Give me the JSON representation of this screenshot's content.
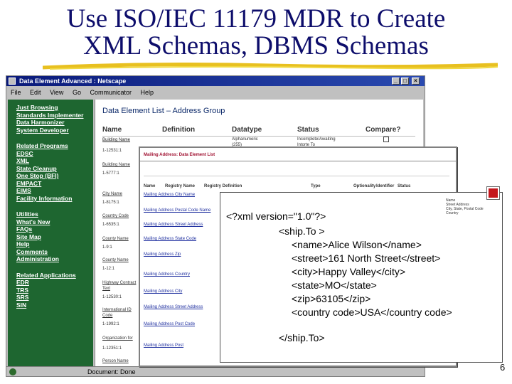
{
  "slide": {
    "title_line1": "Use ISO/IEC 11179 MDR to Create",
    "title_line2": "XML Schemas, DBMS Schemas",
    "number": "6"
  },
  "browser": {
    "title": "Data Element Advanced : Netscape",
    "menu": [
      "File",
      "Edit",
      "View",
      "Go",
      "Communicator",
      "Help"
    ],
    "status": "Document: Done"
  },
  "left_nav": {
    "group1": [
      "Just Browsing",
      "Standards Implementer",
      "Data Harmonizer",
      "System Developer"
    ],
    "group2": [
      "Related Programs",
      "EDSC",
      "XML",
      "State Cleanup",
      "One Stop (BFI)",
      "EMPACT",
      "EIMS",
      "Facility Information"
    ],
    "group3": [
      "Utilities",
      "What's New",
      "FAQs",
      "Site Map",
      "Help",
      "Comments",
      "Administration"
    ],
    "group4": [
      "Related Applications",
      "EDR",
      "TRS",
      "SRS",
      "SIN"
    ]
  },
  "main": {
    "heading": "Data Element List – Address Group",
    "columns": {
      "name": "Name",
      "definition": "Definition",
      "datatype": "Datatype",
      "status": "Status",
      "compare": "Compare?"
    },
    "row_names": [
      "Building Name",
      "1-12531:1",
      "Building Name",
      "1-5777:1",
      "City Name",
      "1-8175:1",
      "Country Code",
      "1-6535:1",
      "County Name",
      "1-9:1",
      "County Name",
      "1-12:1",
      "Highway Contract",
      "Text",
      "1-12530:1",
      "International ID",
      "Code",
      "1-1992:1",
      "Organization for",
      "1-12351:1",
      "Person Name"
    ],
    "row_datatypes": [
      "Alphanumeric",
      "(255)"
    ],
    "row_status": [
      "Incomplete/Awaiting",
      "Intorte To"
    ]
  },
  "overlay": {
    "title": "Mailing Address: Data Element List",
    "columns": [
      "Name",
      "Registry Name",
      "Registry Definition",
      "Type",
      "Optionality",
      "Identifier",
      "Status"
    ],
    "registry_names": [
      "Mailing Address City Name",
      "Mailing Address Postal Code Name",
      "Mailing Address Street Address",
      "Mailing Address State Code",
      "Mailing Address Zip",
      "Mailing Address Country",
      "Mailing Address City",
      "Mailing Address Street Address",
      "Mailing Address Post Code",
      "Mailing Address Post"
    ]
  },
  "xml": {
    "lines": [
      "<?xml version=\"1.0\"?>",
      "<ship.To >",
      "<name>Alice Wilson</name>",
      "<street>161 North Street</street>",
      "<city>Happy Valley</city>",
      "<state>MO</state>",
      "<zip>63105</zip>",
      "<country code>USA</country code>",
      "</ship.To>"
    ],
    "side_note": [
      "Name",
      "Street Address",
      "City, State, Postal Code",
      "Country"
    ]
  },
  "colors": {
    "title": "#0d0d6b",
    "nav_green": "#1e6630",
    "red_box": "#c4161c",
    "titlebar": "#0a1a7a"
  }
}
